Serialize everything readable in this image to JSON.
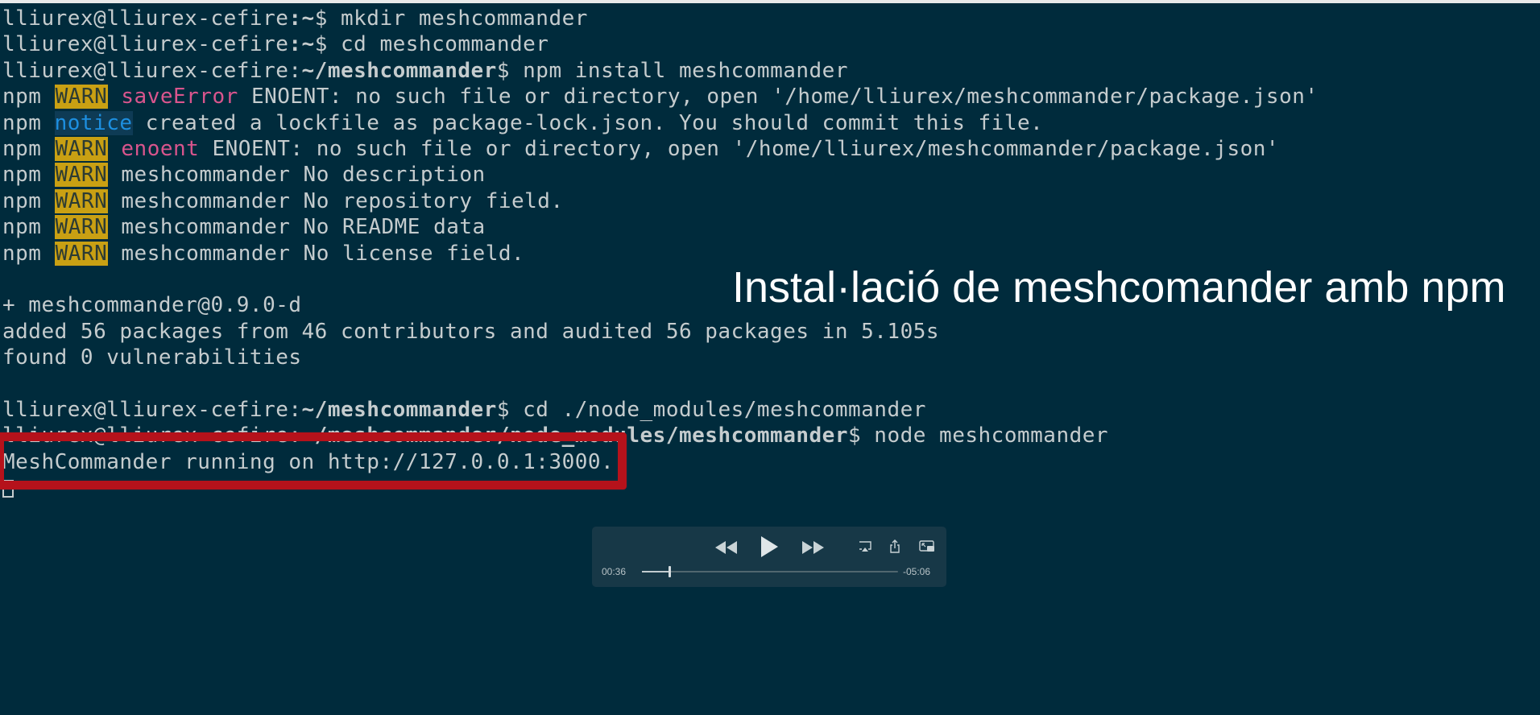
{
  "terminal": {
    "user_host": "lliurex@lliurex-cefire",
    "lines": {
      "l1": {
        "path": ":~",
        "cmd": "$ mkdir meshcommander"
      },
      "l2": {
        "path": ":~",
        "cmd": "$ cd meshcommander"
      },
      "l3": {
        "path_sep": ":",
        "path": "~/meshcommander",
        "cmd": "$ npm install meshcommander"
      },
      "l4": {
        "npm": "npm",
        "tag": "WARN",
        "key": "saveError",
        "text": " ENOENT: no such file or directory, open '/home/lliurex/meshcommander/package.json'"
      },
      "l5": {
        "npm": "npm",
        "tag": "notice",
        "text": " created a lockfile as package-lock.json. You should commit this file."
      },
      "l6": {
        "npm": "npm",
        "tag": "WARN",
        "key": "enoent",
        "text": " ENOENT: no such file or directory, open '/home/lliurex/meshcommander/package.json'"
      },
      "l7": {
        "npm": "npm",
        "tag": "WARN",
        "text": " meshcommander No description"
      },
      "l8": {
        "npm": "npm",
        "tag": "WARN",
        "text": " meshcommander No repository field."
      },
      "l9": {
        "npm": "npm",
        "tag": "WARN",
        "text": " meshcommander No README data"
      },
      "l10": {
        "npm": "npm",
        "tag": "WARN",
        "text": " meshcommander No license field."
      },
      "l11": {
        "text": "+ meshcommander@0.9.0-d"
      },
      "l12": {
        "text": "added 56 packages from 46 contributors and audited 56 packages in 5.105s"
      },
      "l13": {
        "text": "found 0 vulnerabilities"
      },
      "l14": {
        "path_sep": ":",
        "path": "~/meshcommander",
        "cmd": "$ cd ./node_modules/meshcommander"
      },
      "l15": {
        "path_sep": ":",
        "path": "~/meshcommander/node_modules/meshcommander",
        "cmd": "$ node meshcommander"
      },
      "l16": {
        "text": "MeshCommander running on http://127.0.0.1:3000."
      }
    }
  },
  "overlay": {
    "title": "Instal·lació de meshcomander amb npm"
  },
  "player": {
    "elapsed": "00:36",
    "remaining": "-05:06",
    "progress_fraction": 0.106,
    "icons": [
      "rewind-icon",
      "play-icon",
      "fast-forward-icon",
      "airplay-icon",
      "share-icon",
      "picture-in-picture-icon"
    ]
  },
  "colors": {
    "background": "#002b3c",
    "warn_bg": "#c9a013",
    "notice_fg": "#1d8fe0",
    "error_key": "#d9558d",
    "highlight_border": "#b5121b"
  }
}
